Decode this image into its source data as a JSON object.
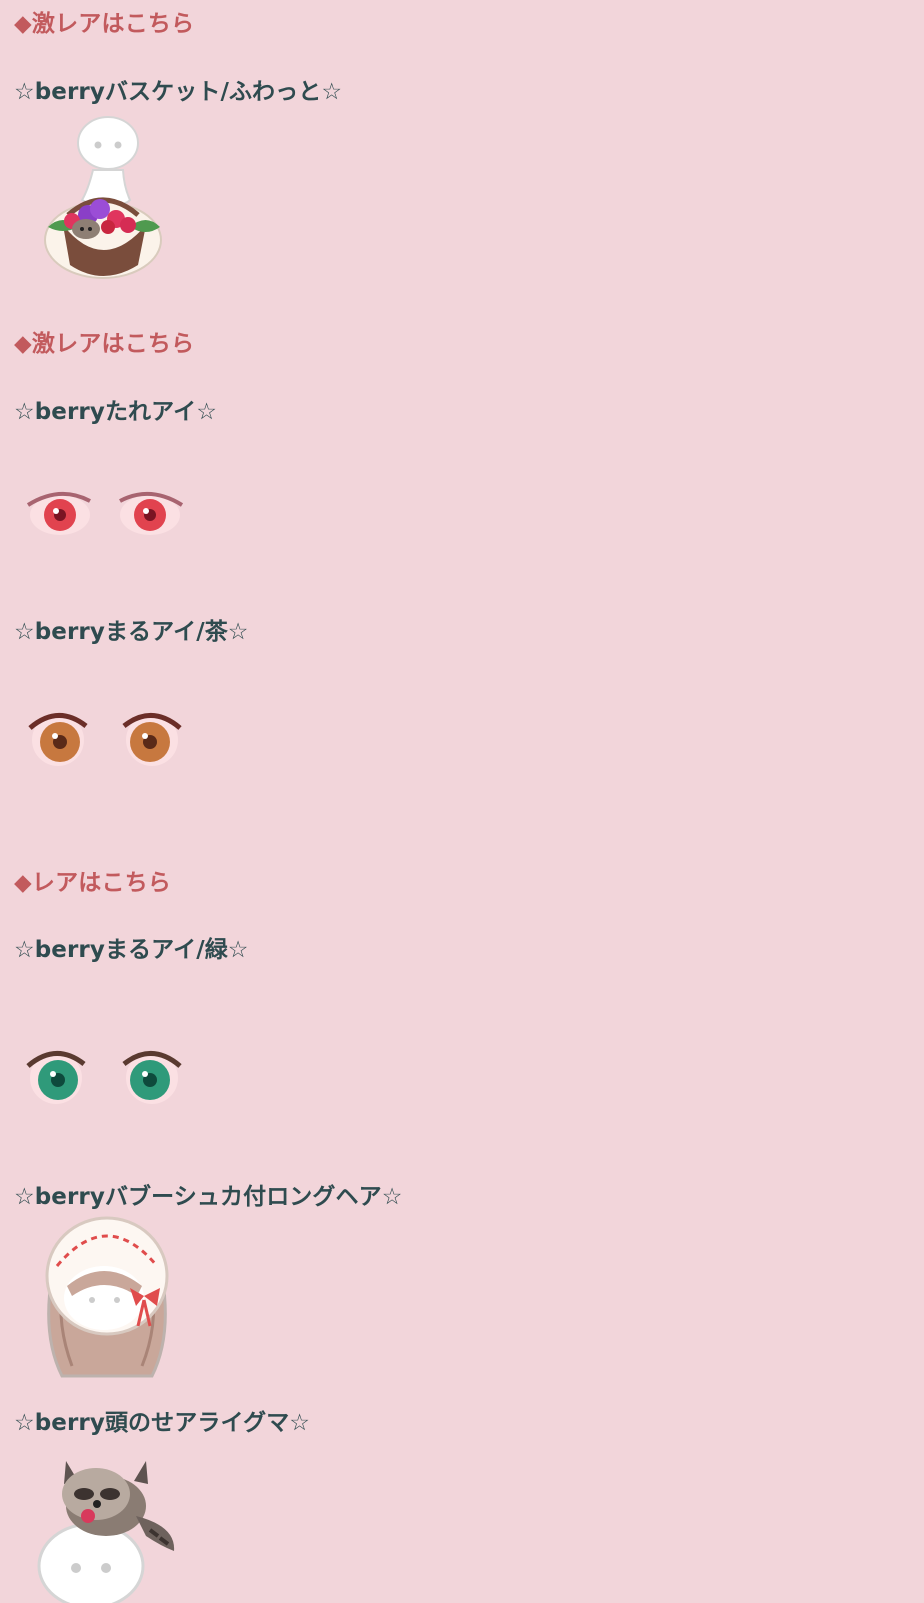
{
  "sections": [
    {
      "heading": "◆激レアはこちら",
      "items": [
        {
          "title": "☆berryバスケット/ふわっと☆",
          "icon": "raccoon-berry-basket-avatar-icon"
        }
      ]
    },
    {
      "heading": "◆激レアはこちら",
      "items": [
        {
          "title": "☆berryたれアイ☆",
          "icon": "red-droopy-eyes-icon"
        },
        {
          "title": "☆berryまるアイ/茶☆",
          "icon": "brown-round-eyes-icon"
        }
      ]
    },
    {
      "heading": "◆レアはこちら",
      "items": [
        {
          "title": "☆berryまるアイ/緑☆",
          "icon": "green-round-eyes-icon"
        },
        {
          "title": "☆berryバブーシュカ付ロングヘア☆",
          "icon": "babushka-long-hair-icon"
        },
        {
          "title": "☆berry頭のせアライグマ☆",
          "icon": "head-raccoon-icon"
        }
      ]
    }
  ],
  "colors": {
    "background": "#f2d5da",
    "heading": "#c25a5d",
    "item_title": "#2f4b4f"
  }
}
